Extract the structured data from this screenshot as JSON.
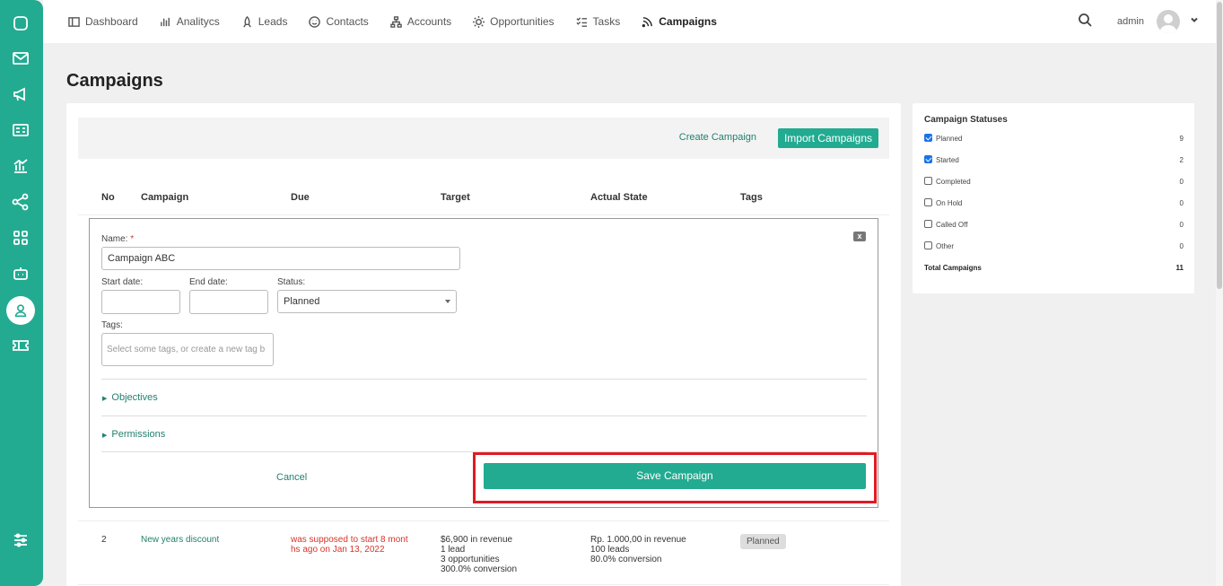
{
  "sidebar": {
    "icons": [
      "chat-icon",
      "mail-icon",
      "megaphone-icon",
      "id-card-icon",
      "chart-icon",
      "share-icon",
      "grid-icon",
      "robot-icon",
      "user-check-icon",
      "ticket-icon",
      "sliders-icon"
    ]
  },
  "nav": {
    "items": [
      {
        "label": "Dashboard",
        "icon": "dashboard-icon"
      },
      {
        "label": "Analitycs",
        "icon": "bar-chart-icon"
      },
      {
        "label": "Leads",
        "icon": "rocket-icon"
      },
      {
        "label": "Contacts",
        "icon": "smiley-icon"
      },
      {
        "label": "Accounts",
        "icon": "hierarchy-icon"
      },
      {
        "label": "Opportunities",
        "icon": "sun-icon"
      },
      {
        "label": "Tasks",
        "icon": "checklist-icon"
      },
      {
        "label": "Campaigns",
        "icon": "rss-icon"
      }
    ],
    "user": "admin"
  },
  "page": {
    "title": "Campaigns"
  },
  "toolbar": {
    "create_label": "Create Campaign",
    "import_label": "Import Campaigns"
  },
  "table": {
    "headers": [
      "No",
      "Campaign",
      "Due",
      "Target",
      "Actual State",
      "Tags"
    ],
    "rows": [
      {
        "no": "2",
        "campaign": "New years discount",
        "due_line1": "was supposed to start 8 mont",
        "due_line2": "hs ago on Jan 13, 2022",
        "target": [
          "$6,900 in revenue",
          "1 lead",
          "3 opportunities",
          "300.0% conversion"
        ],
        "actual": [
          "Rp. 1.000,00 in revenue",
          "100 leads",
          "80.0% conversion"
        ],
        "tag": "Planned"
      }
    ]
  },
  "form": {
    "close_label": "x",
    "name_label": "Name:",
    "required_mark": "*",
    "name_value": "Campaign ABC",
    "start_label": "Start date:",
    "start_value": "",
    "end_label": "End date:",
    "end_value": "",
    "status_label": "Status:",
    "status_value": "Planned",
    "tags_label": "Tags:",
    "tags_placeholder": "Select some tags, or create a new tag b",
    "objectives_label": "Objectives",
    "permissions_label": "Permissions",
    "cancel_label": "Cancel",
    "save_label": "Save Campaign"
  },
  "statuses": {
    "title": "Campaign Statuses",
    "items": [
      {
        "label": "Planned",
        "count": "9",
        "checked": true
      },
      {
        "label": "Started",
        "count": "2",
        "checked": true
      },
      {
        "label": "Completed",
        "count": "0",
        "checked": false
      },
      {
        "label": "On Hold",
        "count": "0",
        "checked": false
      },
      {
        "label": "Called Off",
        "count": "0",
        "checked": false
      },
      {
        "label": "Other",
        "count": "0",
        "checked": false
      }
    ],
    "total_label": "Total Campaigns",
    "total_count": "11"
  },
  "colors": {
    "brand": "#22ab91",
    "link": "#23806e",
    "warning": "#d9342b",
    "highlight": "#e01b24"
  }
}
